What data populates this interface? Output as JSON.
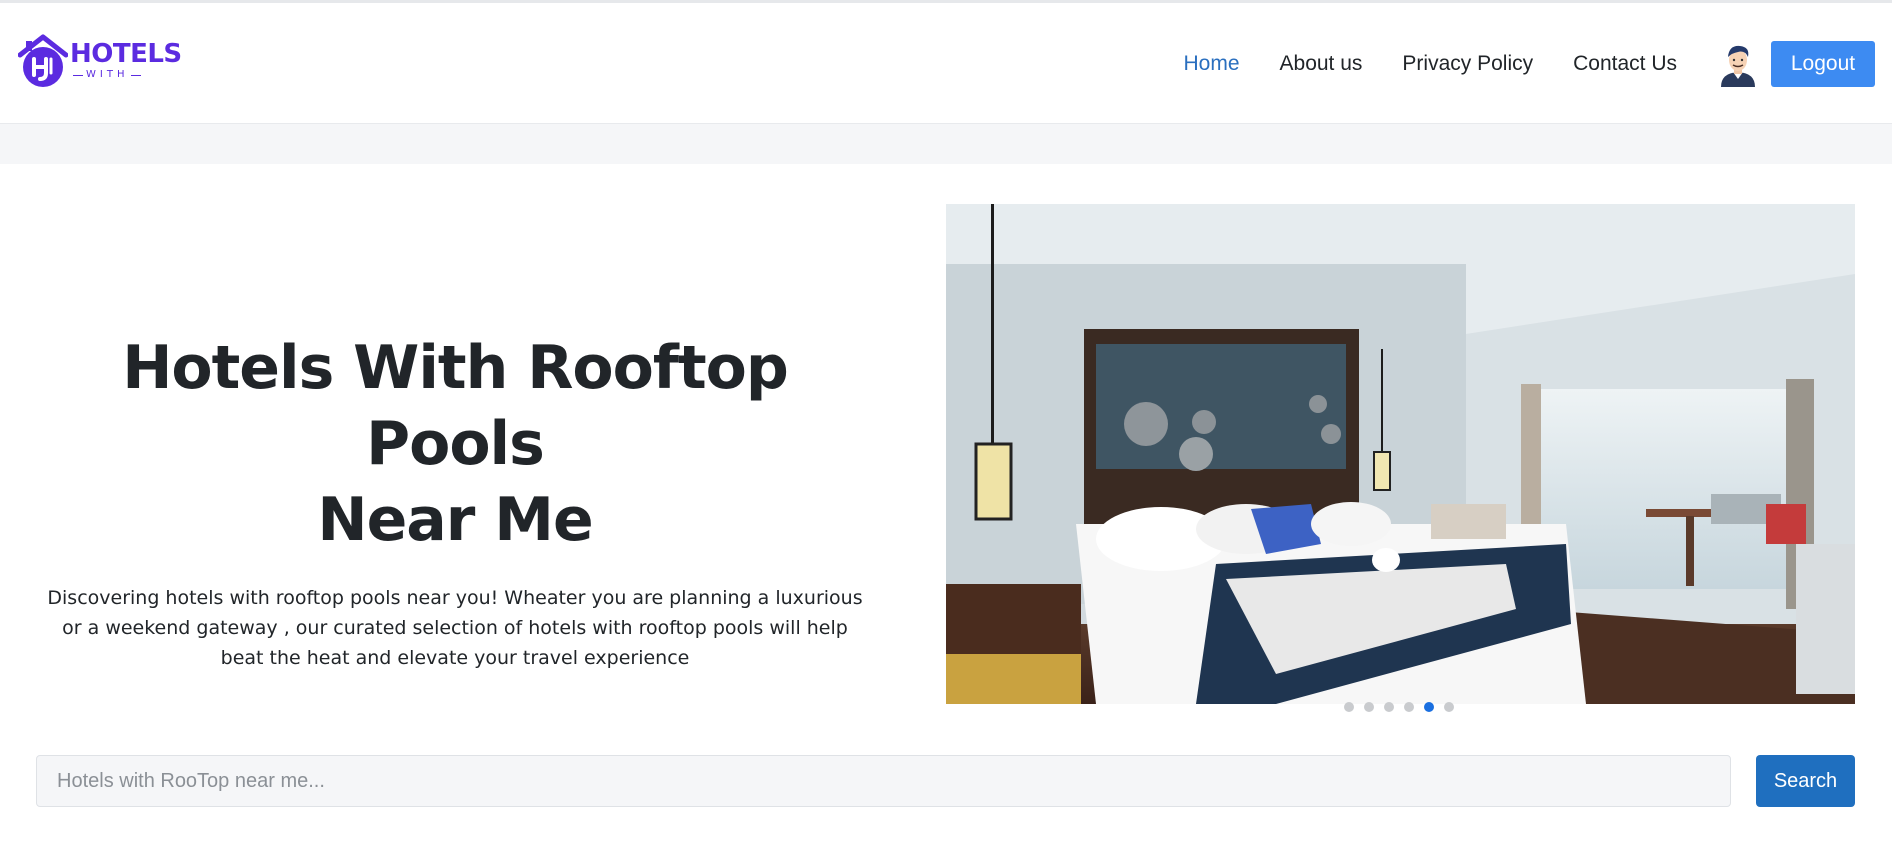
{
  "brand": {
    "name": "HOTELS",
    "sub": "WITH",
    "accent_color": "#5b2be0"
  },
  "nav": {
    "links": [
      "Home",
      "About us",
      "Privacy Policy",
      "Contact Us"
    ],
    "active": "Home",
    "active_color": "#2a6fbf",
    "avatar_icon": "user-avatar-icon",
    "logout_label": "Logout",
    "logout_color": "#3d8bf2"
  },
  "hero": {
    "title_line1": "Hotels With Rooftop Pools",
    "title_line2": "Near Me",
    "description": "Discovering hotels with rooftop pools near you! Wheater you are planning a luxurious or a weekend gateway , our curated selection of hotels with rooftop pools will help beat the heat and elevate your travel experience"
  },
  "carousel": {
    "slide_count": 6,
    "active_index": 4,
    "active_color": "#1a6fe0"
  },
  "search": {
    "placeholder": "Hotels with RooTop near me...",
    "value": "",
    "button_label": "Search",
    "button_color": "#1f6fbf"
  }
}
